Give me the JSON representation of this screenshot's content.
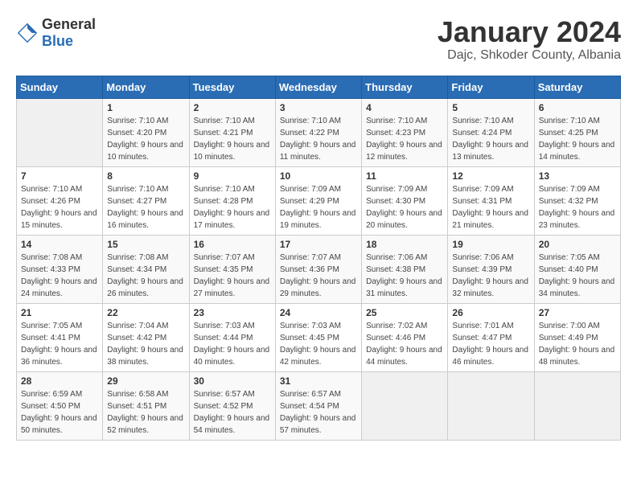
{
  "header": {
    "logo_general": "General",
    "logo_blue": "Blue",
    "month_title": "January 2024",
    "location": "Dajc, Shkoder County, Albania"
  },
  "weekdays": [
    "Sunday",
    "Monday",
    "Tuesday",
    "Wednesday",
    "Thursday",
    "Friday",
    "Saturday"
  ],
  "weeks": [
    [
      {
        "day": "",
        "sunrise": "",
        "sunset": "",
        "daylight": ""
      },
      {
        "day": "1",
        "sunrise": "Sunrise: 7:10 AM",
        "sunset": "Sunset: 4:20 PM",
        "daylight": "Daylight: 9 hours and 10 minutes."
      },
      {
        "day": "2",
        "sunrise": "Sunrise: 7:10 AM",
        "sunset": "Sunset: 4:21 PM",
        "daylight": "Daylight: 9 hours and 10 minutes."
      },
      {
        "day": "3",
        "sunrise": "Sunrise: 7:10 AM",
        "sunset": "Sunset: 4:22 PM",
        "daylight": "Daylight: 9 hours and 11 minutes."
      },
      {
        "day": "4",
        "sunrise": "Sunrise: 7:10 AM",
        "sunset": "Sunset: 4:23 PM",
        "daylight": "Daylight: 9 hours and 12 minutes."
      },
      {
        "day": "5",
        "sunrise": "Sunrise: 7:10 AM",
        "sunset": "Sunset: 4:24 PM",
        "daylight": "Daylight: 9 hours and 13 minutes."
      },
      {
        "day": "6",
        "sunrise": "Sunrise: 7:10 AM",
        "sunset": "Sunset: 4:25 PM",
        "daylight": "Daylight: 9 hours and 14 minutes."
      }
    ],
    [
      {
        "day": "7",
        "sunrise": "Sunrise: 7:10 AM",
        "sunset": "Sunset: 4:26 PM",
        "daylight": "Daylight: 9 hours and 15 minutes."
      },
      {
        "day": "8",
        "sunrise": "Sunrise: 7:10 AM",
        "sunset": "Sunset: 4:27 PM",
        "daylight": "Daylight: 9 hours and 16 minutes."
      },
      {
        "day": "9",
        "sunrise": "Sunrise: 7:10 AM",
        "sunset": "Sunset: 4:28 PM",
        "daylight": "Daylight: 9 hours and 17 minutes."
      },
      {
        "day": "10",
        "sunrise": "Sunrise: 7:09 AM",
        "sunset": "Sunset: 4:29 PM",
        "daylight": "Daylight: 9 hours and 19 minutes."
      },
      {
        "day": "11",
        "sunrise": "Sunrise: 7:09 AM",
        "sunset": "Sunset: 4:30 PM",
        "daylight": "Daylight: 9 hours and 20 minutes."
      },
      {
        "day": "12",
        "sunrise": "Sunrise: 7:09 AM",
        "sunset": "Sunset: 4:31 PM",
        "daylight": "Daylight: 9 hours and 21 minutes."
      },
      {
        "day": "13",
        "sunrise": "Sunrise: 7:09 AM",
        "sunset": "Sunset: 4:32 PM",
        "daylight": "Daylight: 9 hours and 23 minutes."
      }
    ],
    [
      {
        "day": "14",
        "sunrise": "Sunrise: 7:08 AM",
        "sunset": "Sunset: 4:33 PM",
        "daylight": "Daylight: 9 hours and 24 minutes."
      },
      {
        "day": "15",
        "sunrise": "Sunrise: 7:08 AM",
        "sunset": "Sunset: 4:34 PM",
        "daylight": "Daylight: 9 hours and 26 minutes."
      },
      {
        "day": "16",
        "sunrise": "Sunrise: 7:07 AM",
        "sunset": "Sunset: 4:35 PM",
        "daylight": "Daylight: 9 hours and 27 minutes."
      },
      {
        "day": "17",
        "sunrise": "Sunrise: 7:07 AM",
        "sunset": "Sunset: 4:36 PM",
        "daylight": "Daylight: 9 hours and 29 minutes."
      },
      {
        "day": "18",
        "sunrise": "Sunrise: 7:06 AM",
        "sunset": "Sunset: 4:38 PM",
        "daylight": "Daylight: 9 hours and 31 minutes."
      },
      {
        "day": "19",
        "sunrise": "Sunrise: 7:06 AM",
        "sunset": "Sunset: 4:39 PM",
        "daylight": "Daylight: 9 hours and 32 minutes."
      },
      {
        "day": "20",
        "sunrise": "Sunrise: 7:05 AM",
        "sunset": "Sunset: 4:40 PM",
        "daylight": "Daylight: 9 hours and 34 minutes."
      }
    ],
    [
      {
        "day": "21",
        "sunrise": "Sunrise: 7:05 AM",
        "sunset": "Sunset: 4:41 PM",
        "daylight": "Daylight: 9 hours and 36 minutes."
      },
      {
        "day": "22",
        "sunrise": "Sunrise: 7:04 AM",
        "sunset": "Sunset: 4:42 PM",
        "daylight": "Daylight: 9 hours and 38 minutes."
      },
      {
        "day": "23",
        "sunrise": "Sunrise: 7:03 AM",
        "sunset": "Sunset: 4:44 PM",
        "daylight": "Daylight: 9 hours and 40 minutes."
      },
      {
        "day": "24",
        "sunrise": "Sunrise: 7:03 AM",
        "sunset": "Sunset: 4:45 PM",
        "daylight": "Daylight: 9 hours and 42 minutes."
      },
      {
        "day": "25",
        "sunrise": "Sunrise: 7:02 AM",
        "sunset": "Sunset: 4:46 PM",
        "daylight": "Daylight: 9 hours and 44 minutes."
      },
      {
        "day": "26",
        "sunrise": "Sunrise: 7:01 AM",
        "sunset": "Sunset: 4:47 PM",
        "daylight": "Daylight: 9 hours and 46 minutes."
      },
      {
        "day": "27",
        "sunrise": "Sunrise: 7:00 AM",
        "sunset": "Sunset: 4:49 PM",
        "daylight": "Daylight: 9 hours and 48 minutes."
      }
    ],
    [
      {
        "day": "28",
        "sunrise": "Sunrise: 6:59 AM",
        "sunset": "Sunset: 4:50 PM",
        "daylight": "Daylight: 9 hours and 50 minutes."
      },
      {
        "day": "29",
        "sunrise": "Sunrise: 6:58 AM",
        "sunset": "Sunset: 4:51 PM",
        "daylight": "Daylight: 9 hours and 52 minutes."
      },
      {
        "day": "30",
        "sunrise": "Sunrise: 6:57 AM",
        "sunset": "Sunset: 4:52 PM",
        "daylight": "Daylight: 9 hours and 54 minutes."
      },
      {
        "day": "31",
        "sunrise": "Sunrise: 6:57 AM",
        "sunset": "Sunset: 4:54 PM",
        "daylight": "Daylight: 9 hours and 57 minutes."
      },
      {
        "day": "",
        "sunrise": "",
        "sunset": "",
        "daylight": ""
      },
      {
        "day": "",
        "sunrise": "",
        "sunset": "",
        "daylight": ""
      },
      {
        "day": "",
        "sunrise": "",
        "sunset": "",
        "daylight": ""
      }
    ]
  ]
}
